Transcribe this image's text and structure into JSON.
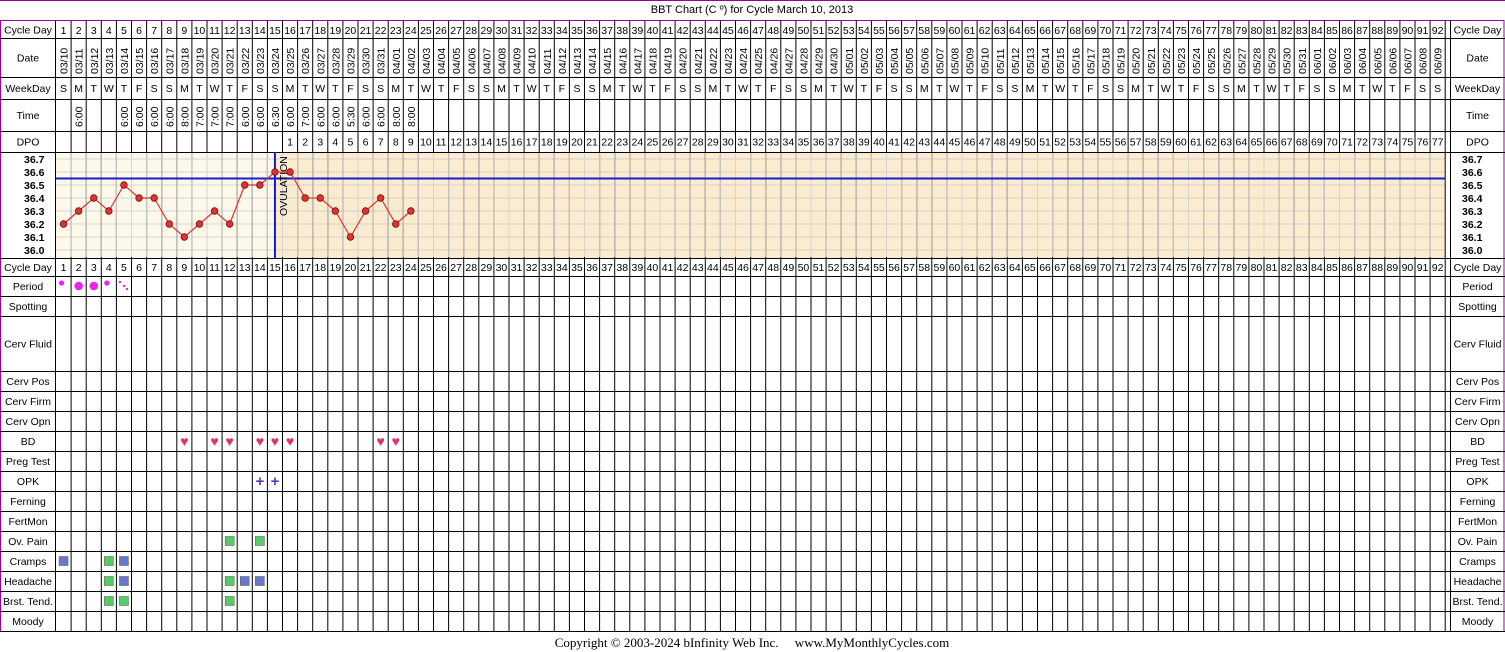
{
  "title": "BBT Chart (C º) for Cycle March 10, 2013",
  "footer": "Copyright © 2003-2024 bInfinity Web Inc.     www.MyMonthlyCycles.com",
  "labels": {
    "cycle_day": "Cycle Day",
    "date": "Date",
    "weekday": "WeekDay",
    "time": "Time",
    "dpo": "DPO",
    "ovulation": "OVULATION"
  },
  "colors": {
    "frame": "#990099",
    "pre_ovulation_bg": "#fdf9ea",
    "post_ovulation_bg": "#fbecd0",
    "temp_line": "#dd3333",
    "ovulation_line": "#1a1acc",
    "coverline": "#1a1acc",
    "heart": "#dd3366",
    "opk": "#6633cc",
    "green_marker": "#55cc66",
    "blue_marker": "#6677cc",
    "period": "#ee22ee"
  },
  "num_days": 92,
  "dates": [
    "03/10",
    "03/11",
    "03/12",
    "03/13",
    "03/14",
    "03/15",
    "03/16",
    "03/17",
    "03/18",
    "03/19",
    "03/20",
    "03/21",
    "03/22",
    "03/23",
    "03/24",
    "03/25",
    "03/26",
    "03/27",
    "03/28",
    "03/29",
    "03/30",
    "03/31",
    "04/01",
    "04/02",
    "04/03",
    "04/04",
    "04/05",
    "04/06",
    "04/07",
    "04/08",
    "04/09",
    "04/10",
    "04/11",
    "04/12",
    "04/13",
    "04/14",
    "04/15",
    "04/16",
    "04/17",
    "04/18",
    "04/19",
    "04/20",
    "04/21",
    "04/22",
    "04/23",
    "04/24",
    "04/25",
    "04/26",
    "04/27",
    "04/28",
    "04/29",
    "04/30",
    "05/01",
    "05/02",
    "05/03",
    "05/04",
    "05/05",
    "05/06",
    "05/07",
    "05/08",
    "05/09",
    "05/10",
    "05/11",
    "05/12",
    "05/13",
    "05/14",
    "05/15",
    "05/16",
    "05/17",
    "05/18",
    "05/19",
    "05/20",
    "05/21",
    "05/22",
    "05/23",
    "05/24",
    "05/25",
    "05/26",
    "05/27",
    "05/28",
    "05/29",
    "05/30",
    "05/31",
    "06/01",
    "06/02",
    "06/03",
    "06/04",
    "06/05",
    "06/06",
    "06/07",
    "06/08",
    "06/09"
  ],
  "weekdays": [
    "S",
    "M",
    "T",
    "W",
    "T",
    "F",
    "S",
    "S",
    "M",
    "T",
    "W",
    "T",
    "F",
    "S",
    "S",
    "M",
    "T",
    "W",
    "T",
    "F",
    "S",
    "S",
    "M",
    "T",
    "W",
    "T",
    "F",
    "S",
    "S",
    "M",
    "T",
    "W",
    "T",
    "F",
    "S",
    "S",
    "M",
    "T",
    "W",
    "T",
    "F",
    "S",
    "S",
    "M",
    "T",
    "W",
    "T",
    "F",
    "S",
    "S",
    "M",
    "T",
    "W",
    "T",
    "F",
    "S",
    "S",
    "M",
    "T",
    "W",
    "T",
    "F",
    "S",
    "S",
    "M",
    "T",
    "W",
    "T",
    "F",
    "S",
    "S",
    "M",
    "T",
    "W",
    "T",
    "F",
    "S",
    "S",
    "M",
    "T",
    "W",
    "T",
    "F",
    "S",
    "S",
    "M",
    "T",
    "W",
    "T",
    "F",
    "S",
    "S"
  ],
  "times": [
    "",
    "6:00",
    "",
    "",
    "6:00",
    "6:00",
    "6:00",
    "6:00",
    "8:00",
    "7:00",
    "7:00",
    "7:00",
    "6:00",
    "6:00",
    "6:30",
    "6:00",
    "7:00",
    "6:00",
    "6:00",
    "5:30",
    "6:00",
    "6:00",
    "8:00",
    "8:00"
  ],
  "dpo": {
    "start_day": 16,
    "count": 77
  },
  "chart_data": {
    "type": "line",
    "x": [
      1,
      2,
      3,
      4,
      5,
      6,
      7,
      8,
      9,
      10,
      11,
      12,
      13,
      14,
      15,
      16,
      17,
      18,
      19,
      20,
      21,
      22,
      23,
      24
    ],
    "values": [
      36.2,
      36.3,
      36.4,
      36.3,
      36.5,
      36.4,
      36.4,
      36.2,
      36.1,
      36.2,
      36.3,
      36.2,
      36.5,
      36.5,
      36.6,
      36.6,
      36.4,
      36.4,
      36.3,
      36.1,
      36.3,
      36.4,
      36.2,
      36.3
    ],
    "y_ticks": [
      "36.7",
      "36.6",
      "36.5",
      "36.4",
      "36.3",
      "36.2",
      "36.1",
      "36.0"
    ],
    "ylim": [
      36.0,
      36.7
    ],
    "ovulation_day": 15,
    "coverline": 36.55,
    "grid": true
  },
  "symptoms": [
    {
      "label": "Period",
      "marks": [
        {
          "day": 1,
          "kind": "period-small"
        },
        {
          "day": 2,
          "kind": "period-large"
        },
        {
          "day": 3,
          "kind": "period-large"
        },
        {
          "day": 4,
          "kind": "period-small"
        },
        {
          "day": 5,
          "kind": "period-spot"
        }
      ]
    },
    {
      "label": "Spotting",
      "marks": []
    },
    {
      "label": "Cerv Fluid",
      "marks": []
    },
    {
      "label": "Cerv Pos",
      "marks": []
    },
    {
      "label": "Cerv Firm",
      "marks": []
    },
    {
      "label": "Cerv Opn",
      "marks": []
    },
    {
      "label": "BD",
      "marks": [
        {
          "day": 9,
          "kind": "heart"
        },
        {
          "day": 11,
          "kind": "heart"
        },
        {
          "day": 12,
          "kind": "heart"
        },
        {
          "day": 14,
          "kind": "heart"
        },
        {
          "day": 15,
          "kind": "heart"
        },
        {
          "day": 16,
          "kind": "heart"
        },
        {
          "day": 22,
          "kind": "heart"
        },
        {
          "day": 23,
          "kind": "heart"
        }
      ]
    },
    {
      "label": "Preg Test",
      "marks": []
    },
    {
      "label": "OPK",
      "marks": [
        {
          "day": 14,
          "kind": "plus"
        },
        {
          "day": 15,
          "kind": "plus"
        }
      ]
    },
    {
      "label": "Ferning",
      "marks": []
    },
    {
      "label": "FertMon",
      "marks": []
    },
    {
      "label": "Ov. Pain",
      "marks": [
        {
          "day": 12,
          "kind": "green"
        },
        {
          "day": 14,
          "kind": "green"
        }
      ]
    },
    {
      "label": "Cramps",
      "marks": [
        {
          "day": 1,
          "kind": "blue"
        },
        {
          "day": 4,
          "kind": "green"
        },
        {
          "day": 5,
          "kind": "blue"
        }
      ]
    },
    {
      "label": "Headache",
      "marks": [
        {
          "day": 4,
          "kind": "green"
        },
        {
          "day": 5,
          "kind": "blue"
        },
        {
          "day": 12,
          "kind": "green"
        },
        {
          "day": 13,
          "kind": "blue"
        },
        {
          "day": 14,
          "kind": "blue"
        }
      ]
    },
    {
      "label": "Brst. Tend.",
      "marks": [
        {
          "day": 4,
          "kind": "green"
        },
        {
          "day": 5,
          "kind": "green"
        },
        {
          "day": 12,
          "kind": "green"
        }
      ]
    },
    {
      "label": "Moody",
      "marks": []
    }
  ]
}
